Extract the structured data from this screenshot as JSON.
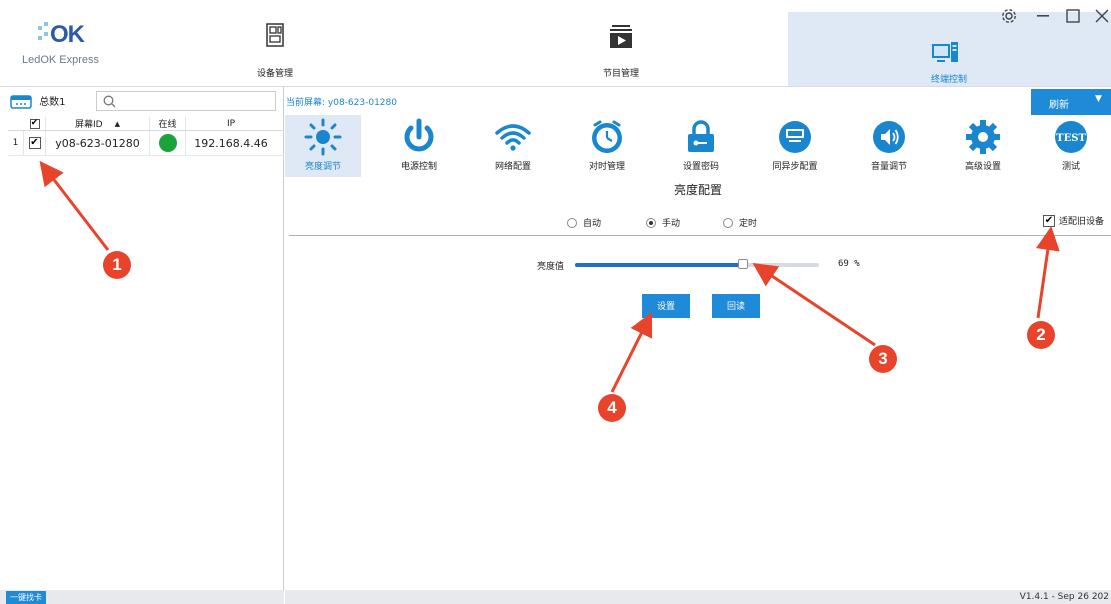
{
  "app": {
    "logo_text": "OK",
    "logo_subtitle": "LedOK Express"
  },
  "nav": {
    "device_management": "设备管理",
    "program_management": "节目管理",
    "terminal_control": "终端控制"
  },
  "left": {
    "total_label": "总数1",
    "table": {
      "headers": [
        "屏幕ID",
        "在线",
        "IP"
      ],
      "rows": [
        {
          "index": "1",
          "checked": true,
          "screen_id": "y08-623-01280",
          "online": true,
          "ip": "192.168.4.46"
        }
      ]
    },
    "footer_button": "一键找卡"
  },
  "right": {
    "current_screen": "当前屏幕: y08-623-01280",
    "refresh_label": "刷新",
    "tools": [
      {
        "label": "亮度调节",
        "icon": "brightness-icon",
        "active": true
      },
      {
        "label": "电源控制",
        "icon": "power-icon",
        "active": false
      },
      {
        "label": "网络配置",
        "icon": "wifi-icon",
        "active": false
      },
      {
        "label": "对时管理",
        "icon": "clock-icon",
        "active": false
      },
      {
        "label": "设置密码",
        "icon": "lock-icon",
        "active": false
      },
      {
        "label": "同异步配置",
        "icon": "sync-icon",
        "active": false
      },
      {
        "label": "音量调节",
        "icon": "volume-icon",
        "active": false
      },
      {
        "label": "高级设置",
        "icon": "gear-icon",
        "active": false
      },
      {
        "label": "测试",
        "icon": "test-icon",
        "active": false
      }
    ],
    "test_icon_text": "TEST",
    "section_title": "亮度配置",
    "modes": {
      "auto": "自动",
      "manual": "手动",
      "scheduled": "定时",
      "selected": "manual"
    },
    "adapt_label": "适配旧设备",
    "adapt_checked": true,
    "brightness_label": "亮度值",
    "brightness_value": 69,
    "brightness_text": "69 %",
    "set_button": "设置",
    "readback_button": "回读"
  },
  "status_bar": {
    "version": "V1.4.1 - Sep 26 202"
  },
  "annotations": [
    "1",
    "2",
    "3",
    "4"
  ],
  "colors": {
    "accent": "#1f8ad7",
    "online": "#1aa33b",
    "annotation": "#e8442b",
    "active_nav": "#dfe9f5"
  }
}
